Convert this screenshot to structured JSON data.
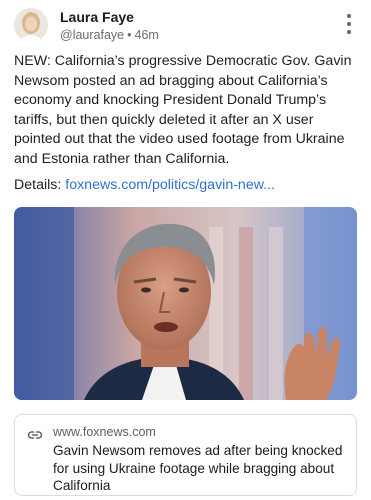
{
  "post": {
    "author": {
      "name": "Laura Faye",
      "handle": "@laurafaye",
      "time_ago": "46m"
    },
    "body": "NEW: California’s progressive Democratic Gov. Gavin Newsom posted an ad bragging about California’s economy and knocking President Donald Trump’s tariffs, but then quickly deleted it after an X user pointed out that the video used footage from Ukraine and Estonia rather than California.",
    "details_label": "Details: ",
    "details_link": "foxnews.com/politics/gavin-new...",
    "link_card": {
      "domain": "www.foxnews.com",
      "title": "Gavin Newsom removes ad after being knocked for using Ukraine footage while bragging about California"
    }
  },
  "icons": {
    "more": "more-vertical-icon",
    "link": "link-icon"
  },
  "colors": {
    "link": "#2f6fd3",
    "text": "#1f1f1f",
    "muted": "#6c6c6c"
  }
}
